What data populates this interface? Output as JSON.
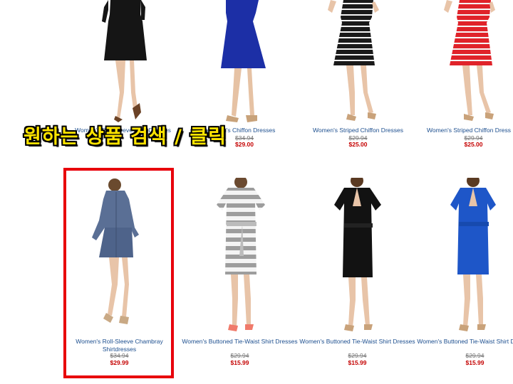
{
  "overlay_text": "원하는 상품 검색 / 클릭",
  "top_row": [
    {
      "name": "Women's Roll-Sleeve Shirt-Dresses",
      "old_price": "",
      "sale_price": "",
      "color": "#1a1a1a"
    },
    {
      "name": "Women's Chiffon Dresses",
      "old_price": "",
      "sale_price": "",
      "color": "#1c2fa6"
    },
    {
      "name": "Women's Striped Chiffon Dresses",
      "old_price": "$29.94",
      "sale_price": "$25.00",
      "color": "#1a1a1a"
    },
    {
      "name": "Women's Striped Chiffon Dress",
      "old_price": "$29.94",
      "sale_price": "$25.00",
      "color": "#e0232a"
    }
  ],
  "top_row_partial": {
    "old": "$34.94",
    "sale": "$29.00"
  },
  "bottom_row": [
    {
      "name": "Women's Roll-Sleeve Chambray Shirtdresses",
      "old_price": "$34.94",
      "sale_price": "$29.99",
      "color": "#5a6f95"
    },
    {
      "name": "Women's Buttoned Tie-Waist Shirt Dresses",
      "old_price": "$29.94",
      "sale_price": "$15.99",
      "color": "#9a9a9a"
    },
    {
      "name": "Women's Buttoned Tie-Waist Shirt Dresses",
      "old_price": "$29.94",
      "sale_price": "$15.99",
      "color": "#111111"
    },
    {
      "name": "Women's Buttoned Tie-Waist Shirt Dresses",
      "old_price": "$29.94",
      "sale_price": "$15.99",
      "color": "#1e56c8"
    }
  ],
  "colors": {
    "highlight": "#e8000b",
    "overlay": "#ffe400",
    "link": "#1d4f8f",
    "sale": "#c40000"
  }
}
